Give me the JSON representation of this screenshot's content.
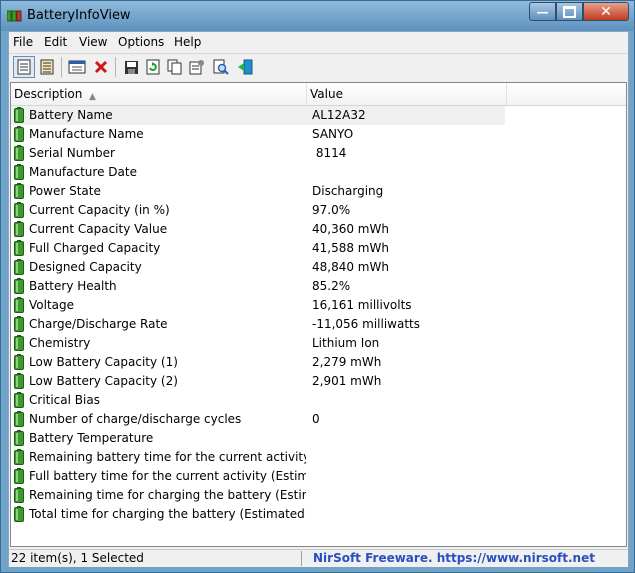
{
  "window": {
    "title": "BatteryInfoView"
  },
  "menu": [
    "File",
    "Edit",
    "View",
    "Options",
    "Help"
  ],
  "toolbar": [
    {
      "name": "html-report-icon"
    },
    {
      "name": "list-view-icon"
    },
    {
      "name": "properties-window-icon"
    },
    {
      "name": "delete-icon"
    },
    {
      "name": "save-icon"
    },
    {
      "name": "refresh-icon"
    },
    {
      "name": "copy-icon"
    },
    {
      "name": "properties-icon"
    },
    {
      "name": "find-icon"
    },
    {
      "name": "exit-icon"
    }
  ],
  "columns": {
    "description": "Description",
    "value": "Value"
  },
  "rows": [
    {
      "desc": "Battery Name",
      "value": "AL12A32"
    },
    {
      "desc": "Manufacture Name",
      "value": "SANYO"
    },
    {
      "desc": "Serial Number",
      "value": " 8114"
    },
    {
      "desc": "Manufacture Date",
      "value": ""
    },
    {
      "desc": "Power State",
      "value": "Discharging"
    },
    {
      "desc": "Current Capacity (in %)",
      "value": "97.0%"
    },
    {
      "desc": "Current Capacity Value",
      "value": "40,360 mWh"
    },
    {
      "desc": "Full Charged Capacity",
      "value": "41,588 mWh"
    },
    {
      "desc": "Designed Capacity",
      "value": "48,840 mWh"
    },
    {
      "desc": "Battery Health",
      "value": "85.2%"
    },
    {
      "desc": "Voltage",
      "value": "16,161 millivolts"
    },
    {
      "desc": "Charge/Discharge Rate",
      "value": "-11,056 milliwatts"
    },
    {
      "desc": "Chemistry",
      "value": "Lithium Ion"
    },
    {
      "desc": "Low Battery Capacity (1)",
      "value": "2,279 mWh"
    },
    {
      "desc": "Low Battery Capacity (2)",
      "value": "2,901 mWh"
    },
    {
      "desc": "Critical Bias",
      "value": ""
    },
    {
      "desc": "Number of charge/discharge cycles",
      "value": "0"
    },
    {
      "desc": "Battery Temperature",
      "value": ""
    },
    {
      "desc": "Remaining battery time for the current activity (Est...",
      "value": ""
    },
    {
      "desc": "Full battery time for the current activity (Estimated)",
      "value": ""
    },
    {
      "desc": "Remaining time for charging the battery (Estimated)",
      "value": ""
    },
    {
      "desc": "Total  time for charging the battery (Estimated)",
      "value": ""
    }
  ],
  "status": {
    "left": "22 item(s), 1 Selected",
    "right": "NirSoft Freeware. https://www.nirsoft.net"
  },
  "colors": {
    "selected_row": "#f0f0f0",
    "link": "#2a4fc0",
    "battery_green": "#3c9a2e"
  }
}
